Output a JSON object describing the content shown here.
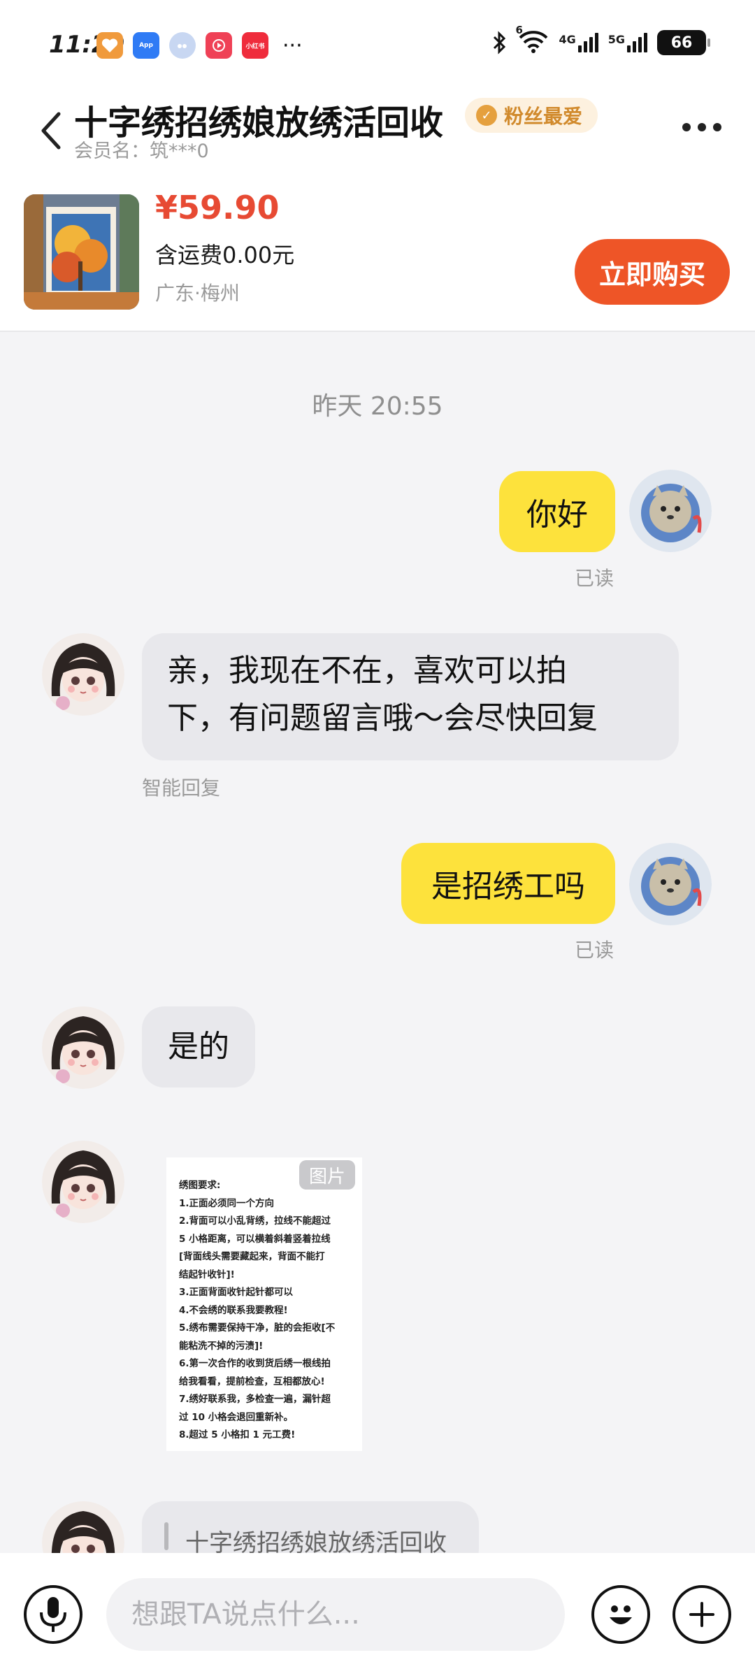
{
  "status_bar": {
    "time": "11:29",
    "apps": [
      {
        "name": "heart-app-icon",
        "label": "",
        "color": "#f09a3c"
      },
      {
        "name": "app-market-icon",
        "label": "App",
        "color": "#2f7bf5"
      },
      {
        "name": "cloud-app-icon",
        "label": "",
        "color": "#c8d7f2"
      },
      {
        "name": "video-app-icon",
        "label": "",
        "color": "#ef4156"
      },
      {
        "name": "xiaohongshu-icon",
        "label": "小红书",
        "color": "#ef2c3c"
      }
    ],
    "more": "···",
    "wifi_tag": "6",
    "sig1_label": "4G",
    "sig2_label": "5G",
    "battery": "66"
  },
  "header": {
    "title": "十字绣招绣娘放绣活回收",
    "badge": "粉丝最爱",
    "member": "会员名：筑***0"
  },
  "product": {
    "price": "¥59.90",
    "shipping": "含运费0.00元",
    "location": "广东·梅州",
    "buy_label": "立即购买"
  },
  "chat": {
    "timestamp": "昨天 20:55",
    "messages": [
      {
        "text": "你好",
        "status": "已读"
      },
      {
        "line1": "亲，我现在不在，喜欢可以拍",
        "line2": "下，有问题留言哦～会尽快回复",
        "tag": "智能回复"
      },
      {
        "text": "是招绣工吗",
        "status": "已读"
      },
      {
        "text": "是的"
      },
      {
        "tag": "图片",
        "lines": [
          "绣图要求:",
          "1.正面必须同一个方向",
          "2.背面可以小乱背绣，拉线不能超过",
          "5 小格距离，可以横着斜着竖着拉线",
          "[背面线头需要藏起来，背面不能打",
          "结起针收针]!",
          "3.正面背面收针起针都可以",
          "4.不会绣的联系我要教程!",
          "5.绣布需要保持干净，脏的会拒收[不",
          "能粘洗不掉的污渍]!",
          "6.第一次合作的收到货后绣一根线拍",
          "给我看看，提前检查，互相都放心!",
          "7.绣好联系我，多检查一遍，漏针超",
          "过 10 小格会退回重新补。",
          "8.超过 5 小格扣 1 元工费!"
        ]
      },
      {
        "quote": "十字绣招绣娘放绣活回收"
      }
    ]
  },
  "input": {
    "placeholder": "想跟TA说点什么..."
  }
}
